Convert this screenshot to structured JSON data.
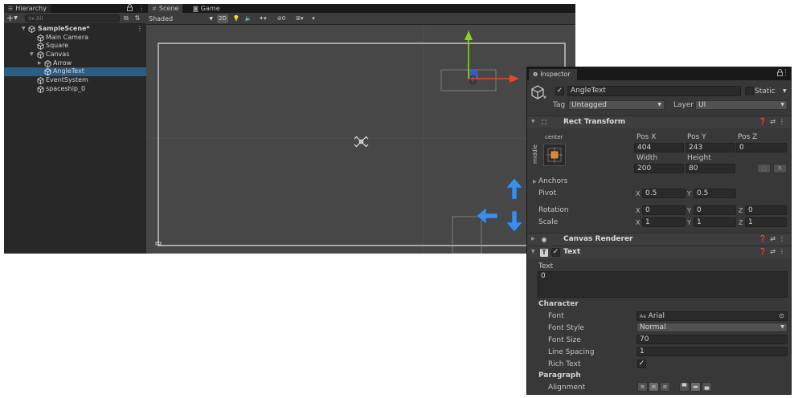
{
  "hierarchy": {
    "tab_label": "Hierarchy",
    "add_label": "+",
    "search_placeholder": "All",
    "scene_name": "SampleScene*",
    "items": [
      {
        "label": "Main Camera"
      },
      {
        "label": "Square"
      },
      {
        "label": "Canvas"
      },
      {
        "label": "Arrow"
      },
      {
        "label": "AngleText"
      },
      {
        "label": "EventSystem"
      },
      {
        "label": "spaceship_0"
      }
    ]
  },
  "scene": {
    "tabs": [
      {
        "label": "Scene"
      },
      {
        "label": "Game"
      }
    ],
    "shading_mode": "Shaded",
    "mode_2d": "2D",
    "hidden_count": "0"
  },
  "inspector": {
    "tab_label": "Inspector",
    "object_name": "AngleText",
    "static_label": "Static",
    "tag_label": "Tag",
    "tag_value": "Untagged",
    "layer_label": "Layer",
    "layer_value": "UI",
    "rect_transform": {
      "title": "Rect Transform",
      "anchor_h": "center",
      "anchor_v": "middle",
      "pos_x_label": "Pos X",
      "pos_x": "404",
      "pos_y_label": "Pos Y",
      "pos_y": "243",
      "pos_z_label": "Pos Z",
      "pos_z": "0",
      "width_label": "Width",
      "width": "200",
      "height_label": "Height",
      "height": "80",
      "reset_label": "R",
      "anchors_label": "Anchors",
      "pivot_label": "Pivot",
      "pivot_x": "0.5",
      "pivot_y": "0.5",
      "rotation_label": "Rotation",
      "rot_x": "0",
      "rot_y": "0",
      "rot_z": "0",
      "scale_label": "Scale",
      "scale_x": "1",
      "scale_y": "1",
      "scale_z": "1",
      "x_axis": "X",
      "y_axis": "Y",
      "z_axis": "Z"
    },
    "canvas_renderer": {
      "title": "Canvas Renderer"
    },
    "text": {
      "title": "Text",
      "text_label": "Text",
      "text_value": "0",
      "character_label": "Character",
      "font_label": "Font",
      "font_prefix": "Aa",
      "font_value": "Arial",
      "font_style_label": "Font Style",
      "font_style_value": "Normal",
      "font_size_label": "Font Size",
      "font_size_value": "70",
      "line_spacing_label": "Line Spacing",
      "line_spacing_value": "1",
      "rich_text_label": "Rich Text",
      "paragraph_label": "Paragraph",
      "alignment_label": "Alignment"
    }
  },
  "colors": {
    "selection": "#2c5d87",
    "gizmo_y": "#8ad22a",
    "gizmo_x": "#e8452c",
    "move_arrows": "#3b8ee8"
  }
}
